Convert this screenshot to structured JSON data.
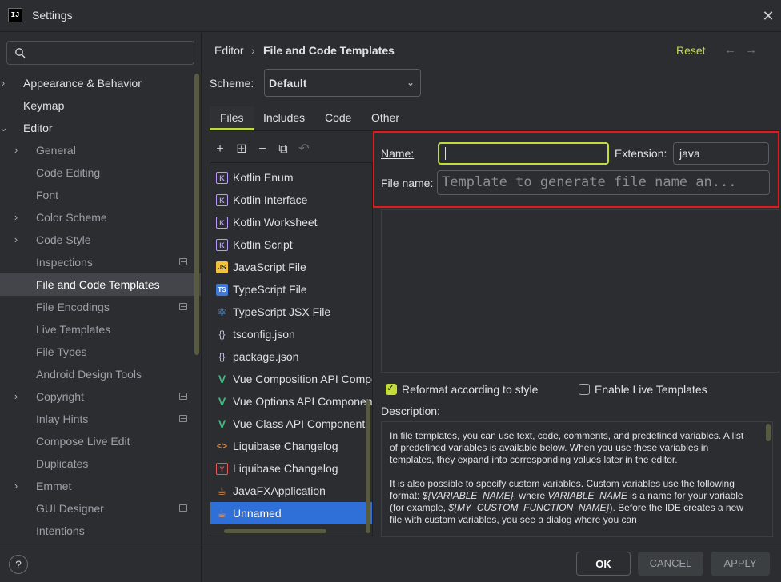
{
  "window": {
    "title": "Settings",
    "close": "✕"
  },
  "search": {
    "placeholder": ""
  },
  "nav": {
    "items": [
      {
        "label": "Appearance & Behavior",
        "arrow": "›"
      },
      {
        "label": "Keymap"
      },
      {
        "label": "Editor",
        "arrow": "⌄"
      },
      {
        "label": "General",
        "arrow": "›"
      },
      {
        "label": "Code Editing"
      },
      {
        "label": "Font"
      },
      {
        "label": "Color Scheme",
        "arrow": "›"
      },
      {
        "label": "Code Style",
        "arrow": "›"
      },
      {
        "label": "Inspections"
      },
      {
        "label": "File and Code Templates"
      },
      {
        "label": "File Encodings"
      },
      {
        "label": "Live Templates"
      },
      {
        "label": "File Types"
      },
      {
        "label": "Android Design Tools"
      },
      {
        "label": "Copyright",
        "arrow": "›"
      },
      {
        "label": "Inlay Hints"
      },
      {
        "label": "Compose Live Edit"
      },
      {
        "label": "Duplicates"
      },
      {
        "label": "Emmet",
        "arrow": "›"
      },
      {
        "label": "GUI Designer"
      },
      {
        "label": "Intentions"
      }
    ]
  },
  "header": {
    "crumb1": "Editor",
    "sep": "›",
    "crumb2": "File and Code Templates",
    "reset": "Reset",
    "back": "←",
    "forward": "→"
  },
  "scheme": {
    "label": "Scheme:",
    "value": "Default"
  },
  "tabs": [
    {
      "label": "Files"
    },
    {
      "label": "Includes"
    },
    {
      "label": "Code"
    },
    {
      "label": "Other"
    }
  ],
  "toolbar": {
    "add": "+",
    "add_child": "⊞",
    "remove": "−",
    "copy": "⧉",
    "reset": "↶"
  },
  "templates": [
    {
      "label": "Kotlin Enum",
      "icon": "K"
    },
    {
      "label": "Kotlin Interface",
      "icon": "K"
    },
    {
      "label": "Kotlin Worksheet",
      "icon": "K"
    },
    {
      "label": "Kotlin Script",
      "icon": "K"
    },
    {
      "label": "JavaScript File",
      "icon": "JS"
    },
    {
      "label": "TypeScript File",
      "icon": "TS"
    },
    {
      "label": "TypeScript JSX File",
      "icon": "⚛"
    },
    {
      "label": "tsconfig.json",
      "icon": "{}"
    },
    {
      "label": "package.json",
      "icon": "{}"
    },
    {
      "label": "Vue Composition API Component",
      "icon": "V"
    },
    {
      "label": "Vue Options API Component",
      "icon": "V"
    },
    {
      "label": "Vue Class API Component",
      "icon": "V"
    },
    {
      "label": "Liquibase Changelog",
      "icon": "</>"
    },
    {
      "label": "Liquibase Changelog",
      "icon": "Y"
    },
    {
      "label": "JavaFXApplication",
      "icon": "☕"
    },
    {
      "label": "Unnamed",
      "icon": "☕"
    }
  ],
  "form": {
    "name_label": "Name:",
    "name_value": "",
    "extension_label": "Extension:",
    "extension_value": "java",
    "filename_label": "File name:",
    "filename_placeholder": "Template to generate file name an..."
  },
  "options": {
    "reformat": {
      "label": "Reformat according to style",
      "checked": true
    },
    "live_templates": {
      "label": "Enable Live Templates",
      "checked": false
    }
  },
  "description": {
    "label": "Description:",
    "p1": "In file templates, you can use text, code, comments, and predefined variables. A list of predefined variables is available below. When you use these variables in templates, they expand into corresponding values later in the editor.",
    "p2_a": "It is also possible to specify custom variables. Custom variables use the following format: ",
    "p2_var1": "${VARIABLE_NAME}",
    "p2_b": ", where ",
    "p2_var2": "VARIABLE_NAME",
    "p2_c": " is a name for your variable (for example, ",
    "p2_var3": "${MY_CUSTOM_FUNCTION_NAME}",
    "p2_d": "). Before the IDE creates a new file with custom variables, you see a dialog where you can"
  },
  "buttons": {
    "help": "?",
    "ok": "OK",
    "cancel": "CANCEL",
    "apply": "APPLY"
  },
  "colors": {
    "accent": "#bfd84a",
    "selection": "#2e6fd8",
    "highlight_border": "#e01b1b",
    "background": "#2b2d30"
  }
}
